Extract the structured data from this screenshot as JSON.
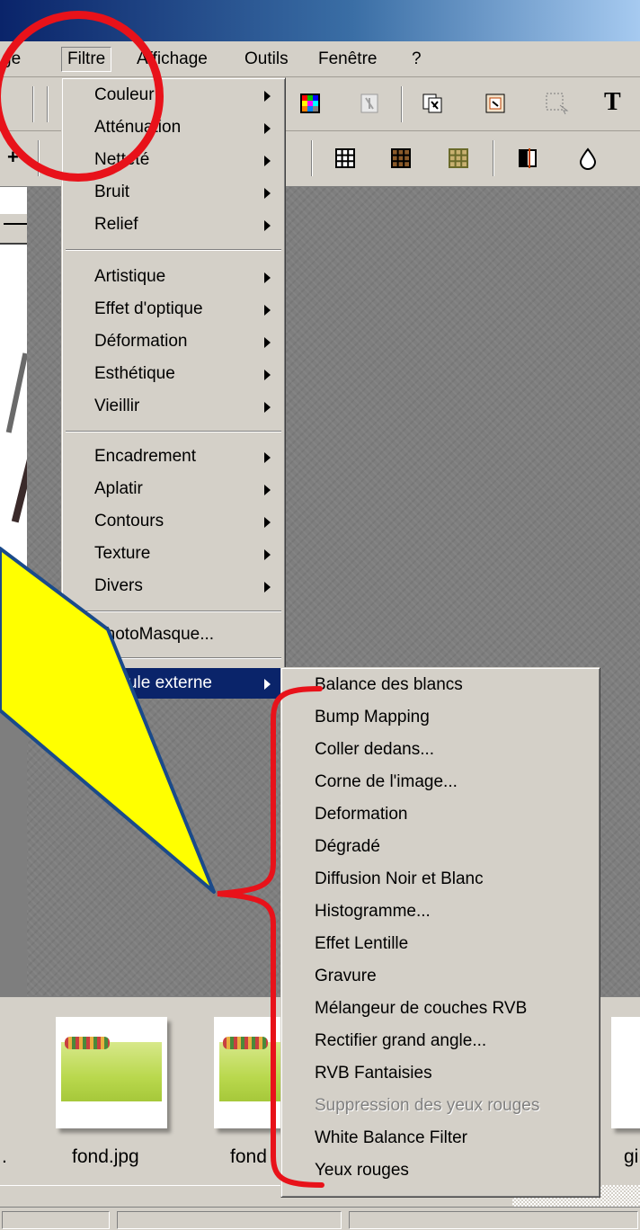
{
  "menubar": {
    "items": [
      "ge",
      "Filtre",
      "Affichage",
      "Outils",
      "Fenêtre",
      "?"
    ]
  },
  "filtre_menu": {
    "groups": [
      [
        "Couleur",
        "Atténuation",
        "Netteté",
        "Bruit",
        "Relief"
      ],
      [
        "Artistique",
        "Effet d'optique",
        "Déformation",
        "Esthétique",
        "Vieillir"
      ],
      [
        "Encadrement",
        "Aplatir",
        "Contours",
        "Texture",
        "Divers"
      ]
    ],
    "photomasque": "PhotoMasque...",
    "module_externe": "Module externe"
  },
  "submenu": {
    "items": [
      {
        "label": "Balance des blancs",
        "enabled": true
      },
      {
        "label": "Bump Mapping",
        "enabled": true
      },
      {
        "label": "Coller dedans...",
        "enabled": true
      },
      {
        "label": "Corne de l'image...",
        "enabled": true
      },
      {
        "label": "Deformation",
        "enabled": true
      },
      {
        "label": "Dégradé",
        "enabled": true
      },
      {
        "label": "Diffusion Noir et Blanc",
        "enabled": true
      },
      {
        "label": "Histogramme...",
        "enabled": true
      },
      {
        "label": "Effet Lentille",
        "enabled": true
      },
      {
        "label": "Gravure",
        "enabled": true
      },
      {
        "label": "Mélangeur de couches RVB",
        "enabled": true
      },
      {
        "label": "Rectifier grand angle...",
        "enabled": true
      },
      {
        "label": "RVB Fantaisies",
        "enabled": true
      },
      {
        "label": "Suppression des yeux rouges",
        "enabled": false
      },
      {
        "label": "White Balance Filter",
        "enabled": true
      },
      {
        "label": "Yeux rouges",
        "enabled": true
      }
    ]
  },
  "thumbnails": {
    "labels": [
      ".",
      "fond.jpg",
      "fond",
      "gi"
    ]
  },
  "toolbar": {
    "text_tool": "T",
    "icons": [
      "color-palette-icon",
      "effect-icon",
      "image-edit-icon",
      "frame-icon",
      "selection-icon",
      "text-tool-icon",
      "grid-icon",
      "dark-grid-icon",
      "light-grid-icon",
      "half-fill-icon",
      "drop-icon"
    ]
  },
  "colors": {
    "highlight": "#0a246a",
    "annotation_red": "#e8121a",
    "callout_yellow": "#ffff00",
    "callout_border": "#1a4a8a",
    "menu_bg": "#d4d0c8"
  }
}
